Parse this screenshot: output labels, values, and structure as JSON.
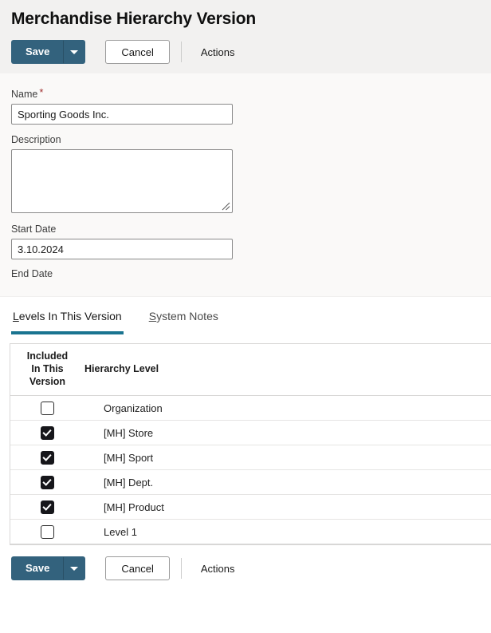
{
  "page": {
    "title": "Merchandise Hierarchy Version"
  },
  "colors": {
    "accent": "#1a7490",
    "primary_button": "#33627d",
    "required_marker": "#a03030",
    "header_band": "#f2f1f0",
    "form_background": "#faf9f8"
  },
  "toolbar_top": {
    "save_label": "Save",
    "save_menu_icon": "chevron-down-icon",
    "cancel_label": "Cancel",
    "actions_label": "Actions"
  },
  "toolbar_bottom": {
    "save_label": "Save",
    "save_menu_icon": "chevron-down-icon",
    "cancel_label": "Cancel",
    "actions_label": "Actions"
  },
  "form": {
    "name": {
      "label": "Name",
      "required_marker": "*",
      "value": "Sporting Goods Inc.",
      "placeholder": ""
    },
    "description": {
      "label": "Description",
      "value": "",
      "placeholder": ""
    },
    "start_date": {
      "label": "Start Date",
      "value": "3.10.2024",
      "placeholder": ""
    },
    "end_date": {
      "label": "End Date",
      "value": "",
      "placeholder": ""
    }
  },
  "tabs": [
    {
      "label": "Levels In This Version",
      "access_key": "L",
      "rest": "evels In This Version",
      "active": true
    },
    {
      "label": "System Notes",
      "access_key": "S",
      "rest": "ystem Notes",
      "active": false
    }
  ],
  "levels_table": {
    "columns": {
      "included": [
        "Included",
        "In This",
        "Version"
      ],
      "hierarchy_level": "Hierarchy Level"
    },
    "rows": [
      {
        "included": false,
        "level": "Organization"
      },
      {
        "included": true,
        "level": "[MH] Store"
      },
      {
        "included": true,
        "level": "[MH] Sport"
      },
      {
        "included": true,
        "level": "[MH] Dept."
      },
      {
        "included": true,
        "level": "[MH] Product"
      },
      {
        "included": false,
        "level": "Level 1"
      }
    ]
  }
}
